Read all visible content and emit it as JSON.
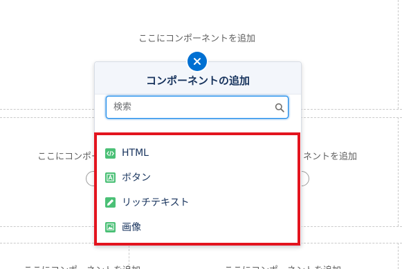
{
  "canvas": {
    "regions": [
      {
        "label": "ここにコンポーネントを追加"
      },
      {
        "label_left": "ここにコンポー"
      },
      {
        "label_right": "ネントを追加"
      },
      {
        "label_bottom_left": "ここにコンポーネントを追加"
      },
      {
        "label_bottom_right": "ここにコンポーネントを追加"
      }
    ]
  },
  "popup": {
    "title": "コンポーネントの追加",
    "search": {
      "placeholder": "検索",
      "value": ""
    },
    "items": [
      {
        "label": "HTML",
        "icon": "code-icon"
      },
      {
        "label": "ボタン",
        "icon": "button-icon"
      },
      {
        "label": "リッチテキスト",
        "icon": "pencil-icon"
      },
      {
        "label": "画像",
        "icon": "image-icon"
      }
    ]
  },
  "colors": {
    "accent": "#0070d2",
    "highlight": "#e3141e",
    "item_icon_bg": "#4bc076",
    "title_text": "#16325c"
  }
}
